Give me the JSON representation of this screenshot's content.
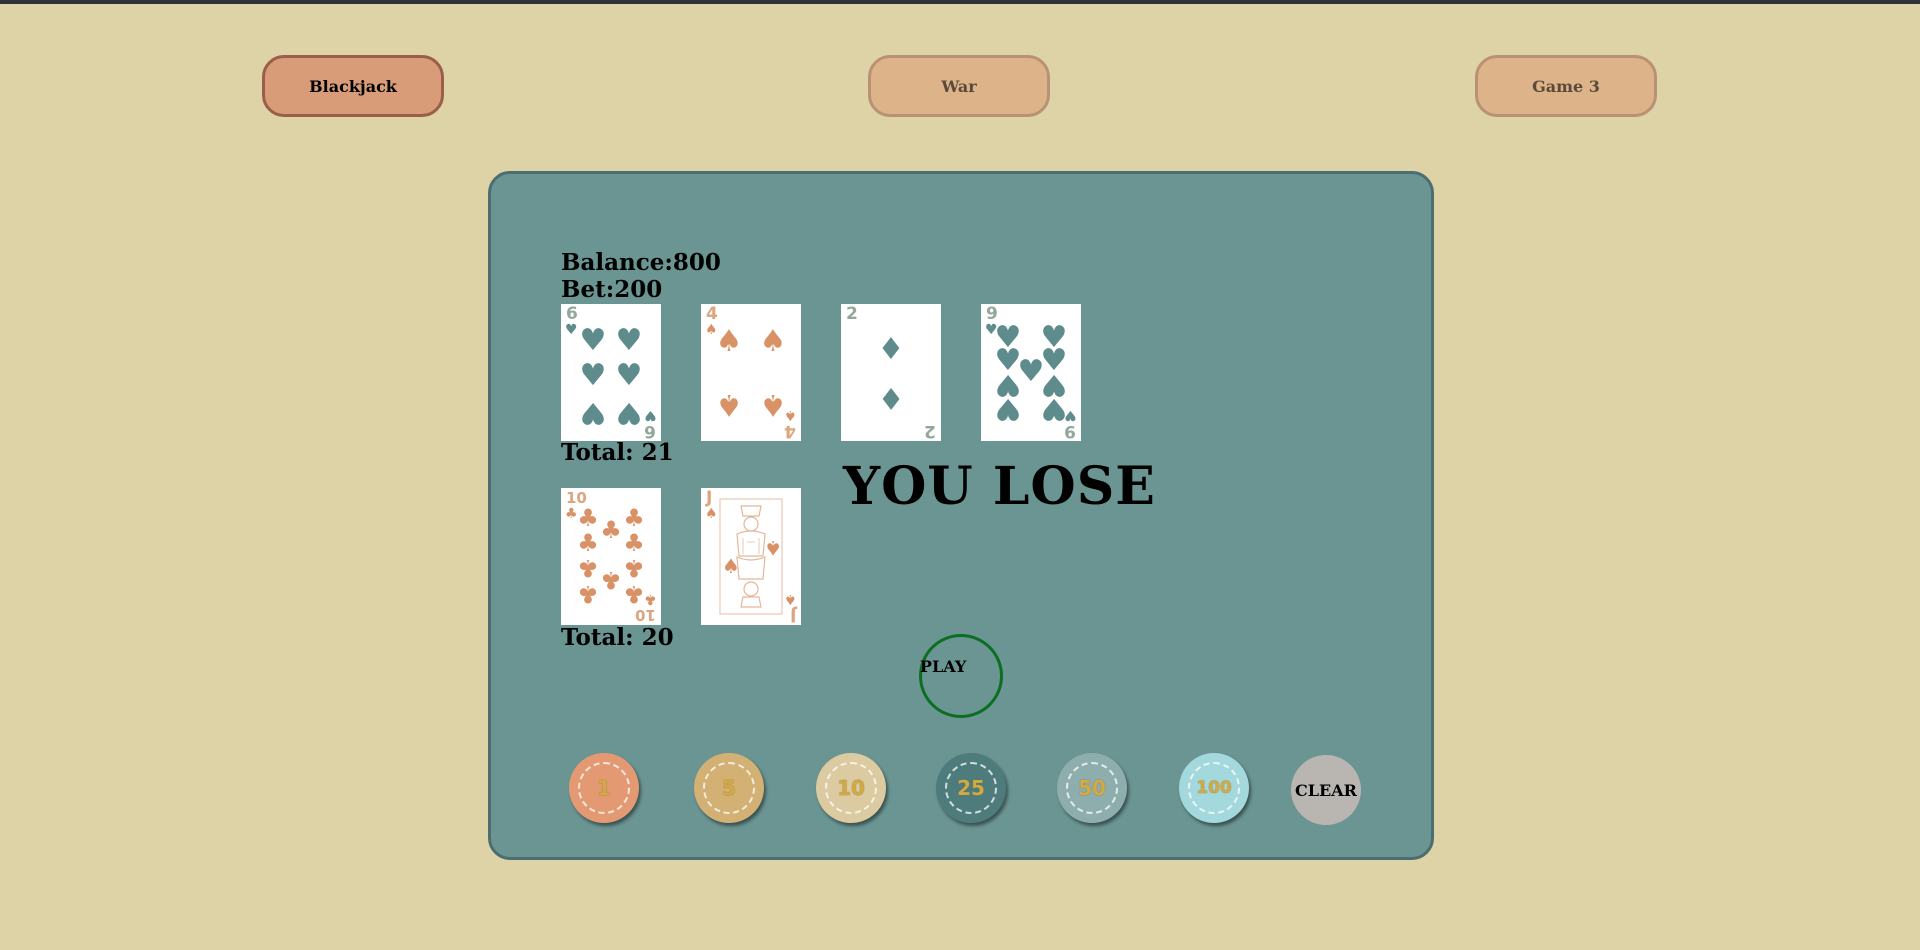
{
  "nav": {
    "tabs": [
      {
        "label": "Blackjack",
        "active": true
      },
      {
        "label": "War",
        "active": false
      },
      {
        "label": "Game 3",
        "active": false
      }
    ]
  },
  "status": {
    "balance_label": "Balance:800",
    "bet_label": "Bet:200"
  },
  "dealer_hand": {
    "cards": [
      {
        "rank": "6",
        "suit": "hearts"
      },
      {
        "rank": "4",
        "suit": "spades"
      },
      {
        "rank": "2",
        "suit": "diamonds"
      },
      {
        "rank": "9",
        "suit": "hearts"
      }
    ],
    "total_label": "Total: 21"
  },
  "player_hand": {
    "cards": [
      {
        "rank": "10",
        "suit": "clubs"
      },
      {
        "rank": "J",
        "suit": "spades"
      }
    ],
    "total_label": "Total: 20"
  },
  "result": "YOU LOSE",
  "controls": {
    "play_label": "PLAY",
    "clear_label": "CLEAR"
  },
  "chips": [
    {
      "value": "1",
      "color": "#e39a72"
    },
    {
      "value": "5",
      "color": "#d3b074"
    },
    {
      "value": "10",
      "color": "#dccaa0"
    },
    {
      "value": "25",
      "color": "#4e7c7c"
    },
    {
      "value": "50",
      "color": "#8eaeae"
    },
    {
      "value": "100",
      "color": "#a3d8dc"
    }
  ],
  "colors": {
    "background": "#ddd3a7",
    "table": "#6a9593",
    "active_tab": "#d89c78",
    "inactive_tab": "#ddb389"
  }
}
